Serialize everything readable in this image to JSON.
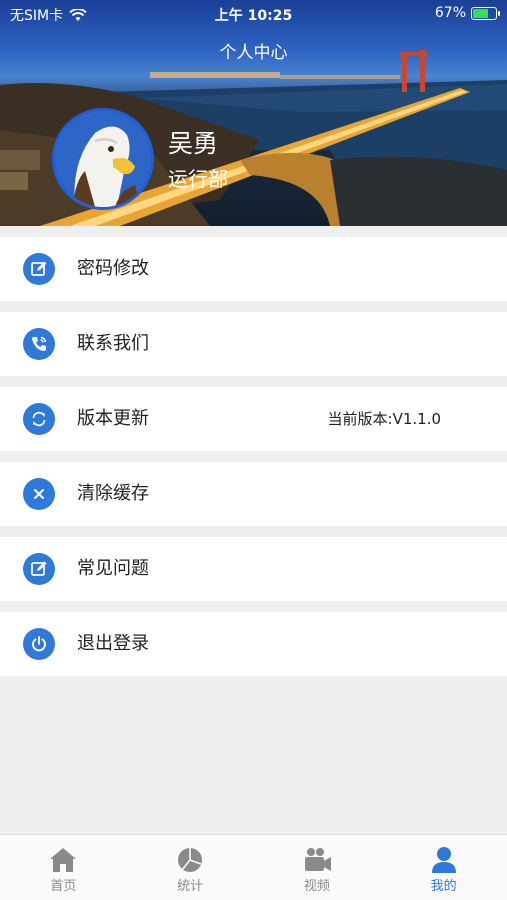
{
  "status_bar": {
    "carrier": "无SIM卡",
    "time": "上午 10:25",
    "battery": "67%",
    "battery_level": 0.67,
    "wifi_icon": "wifi-icon",
    "battery_icon": "battery-charging-icon"
  },
  "header": {
    "title": "个人中心",
    "avatar_icon": "eagle-avatar",
    "user_name": "吴勇",
    "department": "运行部"
  },
  "menu": {
    "items": [
      {
        "label": "密码修改",
        "icon": "edit-icon"
      },
      {
        "label": "联系我们",
        "icon": "phone-icon"
      },
      {
        "label": "版本更新",
        "icon": "refresh-icon",
        "value": "当前版本:V1.1.0"
      },
      {
        "label": "清除缓存",
        "icon": "close-icon"
      },
      {
        "label": "常见问题",
        "icon": "edit-icon"
      },
      {
        "label": "退出登录",
        "icon": "power-icon"
      }
    ]
  },
  "tabbar": {
    "tabs": [
      {
        "label": "首页",
        "icon": "home-icon",
        "active": false
      },
      {
        "label": "统计",
        "icon": "pie-chart-icon",
        "active": false
      },
      {
        "label": "视频",
        "icon": "video-camera-icon",
        "active": false
      },
      {
        "label": "我的",
        "icon": "user-icon",
        "active": true
      }
    ]
  },
  "colors": {
    "accent": "#2f79d9",
    "background": "#efefef",
    "inactive_tab": "#8a8a8a"
  }
}
